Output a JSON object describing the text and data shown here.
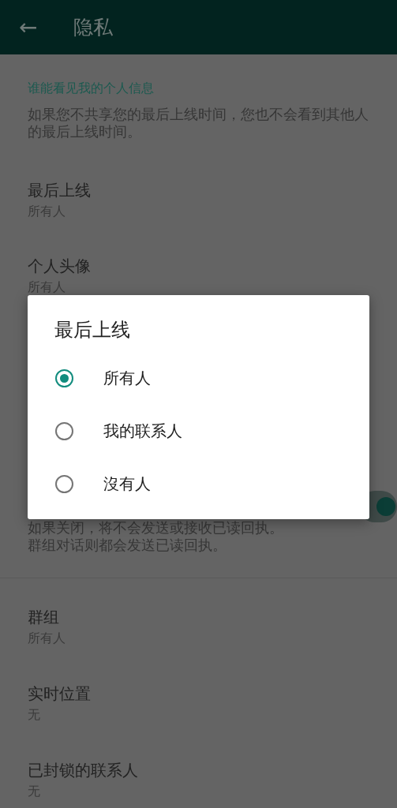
{
  "app_bar": {
    "back": "←",
    "title": "隐私"
  },
  "section": {
    "title": "谁能看见我的个人信息",
    "description": "如果您不共享您的最后上线时间，您也不会看到其他人的最后上线时间。"
  },
  "settings_top": [
    {
      "title": "最后上线",
      "value": "所有人"
    },
    {
      "title": "个人头像",
      "value": "所有人"
    }
  ],
  "read_receipts": {
    "description_lines": [
      "如果关闭，将不会发送或接收已读回执。",
      "群组对话则都会发送已读回执。"
    ],
    "on": true
  },
  "settings_bottom": [
    {
      "title": "群组",
      "value": "所有人"
    },
    {
      "title": "实时位置",
      "value": "无"
    },
    {
      "title": "已封锁的联系人",
      "value": "无"
    }
  ],
  "dialog": {
    "title": "最后上线",
    "options": [
      {
        "label": "所有人",
        "selected": true
      },
      {
        "label": "我的联系人",
        "selected": false
      },
      {
        "label": "沒有人",
        "selected": false
      }
    ]
  }
}
